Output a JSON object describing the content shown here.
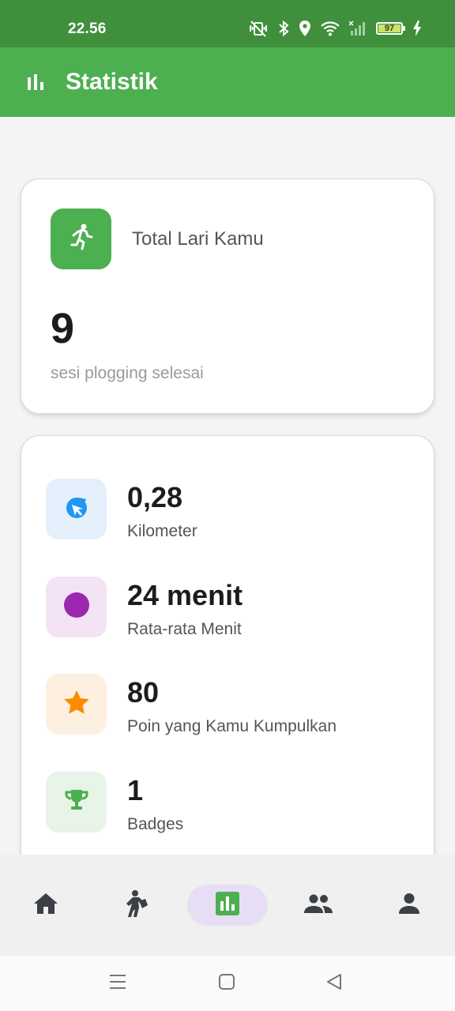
{
  "status_bar": {
    "time": "22.56",
    "battery_level": "97",
    "icons": [
      "vibrate-off-icon",
      "bluetooth-icon",
      "location-icon",
      "wifi-icon",
      "signal-icon",
      "battery-icon",
      "charging-icon"
    ]
  },
  "app_bar": {
    "title": "Statistik",
    "icon": "bar-chart-icon"
  },
  "total_card": {
    "icon": "running-icon",
    "label": "Total Lari Kamu",
    "value": "9",
    "caption": "sesi plogging selesai",
    "tile_color": "#4caf50"
  },
  "stats": [
    {
      "icon": "distance-icon",
      "value": "0,28",
      "label": "Kilometer",
      "tile_color": "#e3f0fb",
      "icon_color": "#2196f3"
    },
    {
      "icon": "circle-icon",
      "value": "24 menit",
      "label": "Rata-rata Menit",
      "tile_color": "#f3e3f4",
      "icon_color": "#9c27b0"
    },
    {
      "icon": "star-icon",
      "value": "80",
      "label": "Poin yang Kamu Kumpulkan",
      "tile_color": "#fdf0e0",
      "icon_color": "#fb8c00"
    },
    {
      "icon": "trophy-icon",
      "value": "1",
      "label": "Badges",
      "tile_color": "#e8f4e8",
      "icon_color": "#4caf50"
    }
  ],
  "bottom_nav": {
    "items": [
      {
        "icon": "home-icon",
        "active": false
      },
      {
        "icon": "plogging-icon",
        "active": false
      },
      {
        "icon": "bar-chart-icon",
        "active": true
      },
      {
        "icon": "people-icon",
        "active": false
      },
      {
        "icon": "person-icon",
        "active": false
      }
    ],
    "active_color": "#4caf50",
    "active_bg": "#e7def6",
    "inactive_color": "#3c3f44"
  },
  "system_nav": {
    "buttons": [
      "menu-icon",
      "home-square-icon",
      "back-triangle-icon"
    ]
  }
}
